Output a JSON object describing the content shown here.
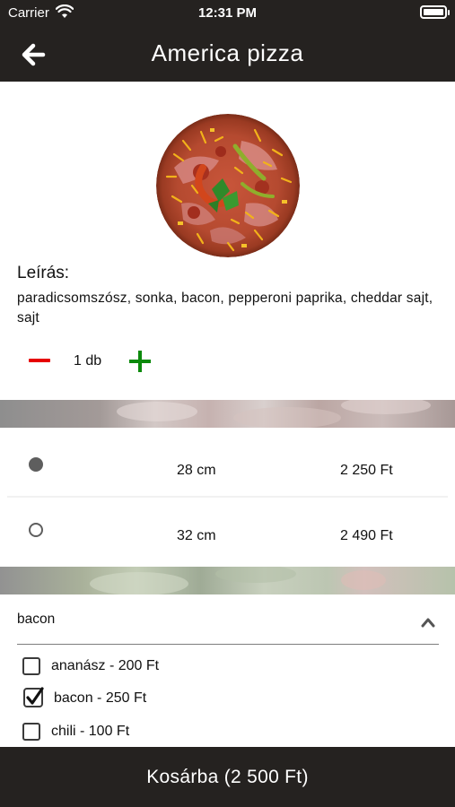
{
  "status_bar": {
    "carrier": "Carrier",
    "time": "12:31 PM"
  },
  "nav": {
    "title": "America pizza",
    "back_icon": "arrow-left-icon"
  },
  "product": {
    "image": "pizza-image",
    "description_label": "Leírás:",
    "description": "paradicsomszósz, sonka, bacon, pepperoni paprika, cheddar sajt, sajt"
  },
  "quantity": {
    "value": "1 db"
  },
  "sizes": [
    {
      "size": "28 cm",
      "price": "2 250 Ft",
      "selected": true
    },
    {
      "size": "32 cm",
      "price": "2 490 Ft",
      "selected": false
    }
  ],
  "extras_dropdown": {
    "selected": "bacon"
  },
  "extras": [
    {
      "label": "ananász - 200 Ft",
      "checked": false
    },
    {
      "label": "bacon - 250 Ft",
      "checked": true
    },
    {
      "label": "chili - 100 Ft",
      "checked": false
    }
  ],
  "cart_button": {
    "label": "Kosárba (2 500 Ft)"
  },
  "colors": {
    "bar": "#252220",
    "minus": "#e60000",
    "plus": "#0c8a0c"
  }
}
